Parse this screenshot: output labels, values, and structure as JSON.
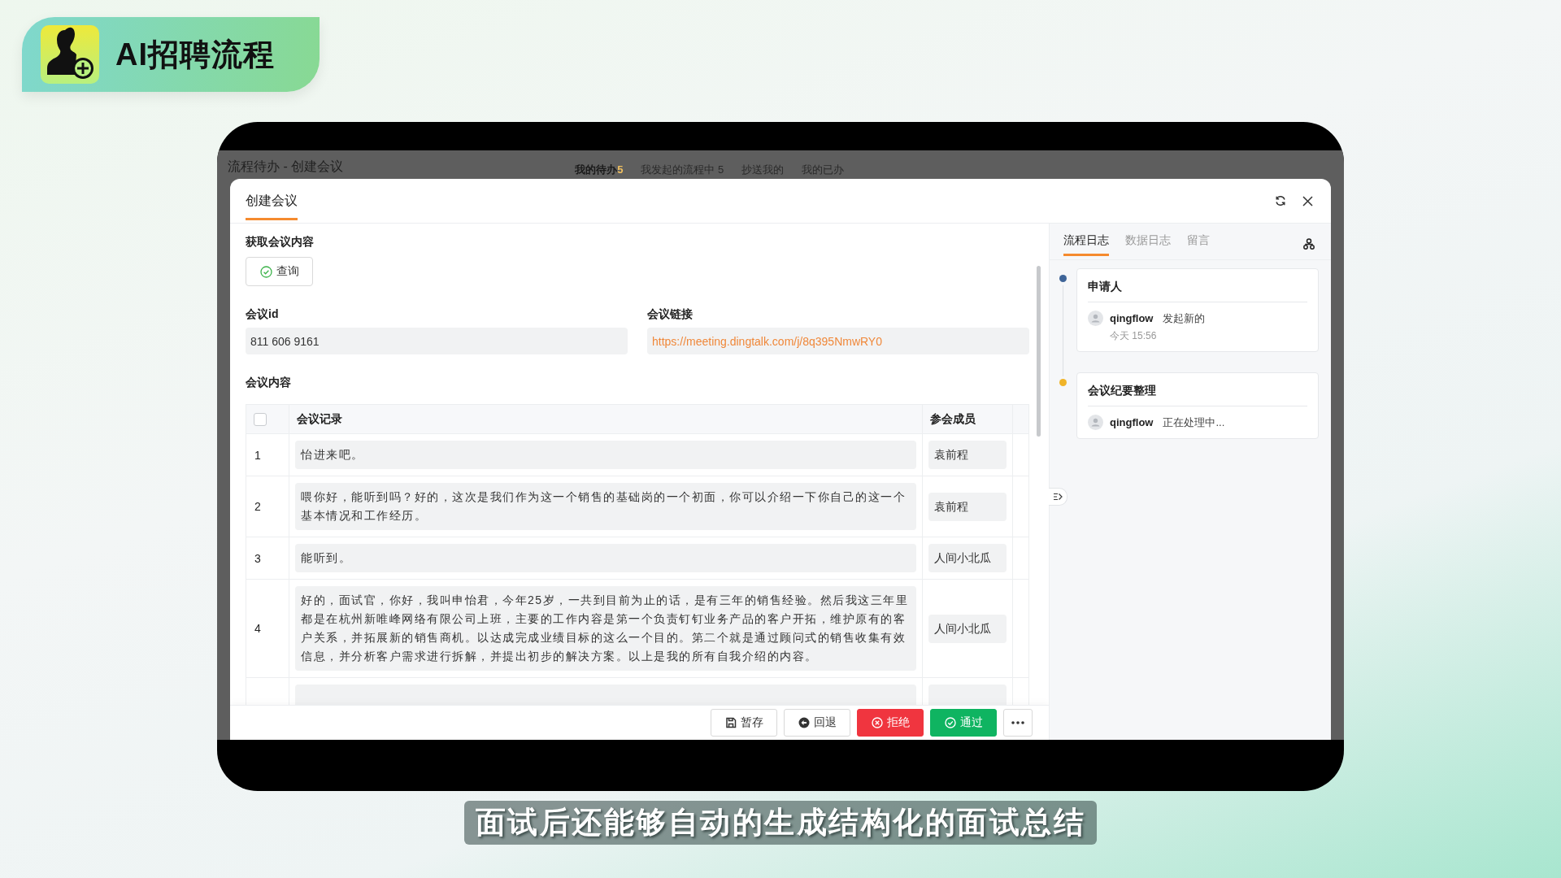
{
  "badge": {
    "title": "AI招聘流程"
  },
  "background_page": {
    "title": "流程待办 - 创建会议",
    "tabs": [
      {
        "label": "我的待办",
        "count": "5",
        "selected": true
      },
      {
        "label": "我发起的流程中 5",
        "selected": false
      },
      {
        "label": "抄送我的",
        "selected": false
      },
      {
        "label": "我的已办",
        "selected": false
      }
    ]
  },
  "modal": {
    "title": "创建会议",
    "fetch_label": "获取会议内容",
    "query_button": "查询",
    "fields": [
      {
        "label": "会议id",
        "value": "811 606 9161",
        "kind": "text"
      },
      {
        "label": "会议链接",
        "value": "https://meeting.dingtalk.com/j/8q395NmwRY0",
        "kind": "link"
      }
    ],
    "content_label": "会议内容",
    "table": {
      "columns": [
        "会议记录",
        "参会成员"
      ],
      "header_checked": false,
      "rows": [
        {
          "index": "1",
          "record": "怡进来吧。",
          "member": "袁前程"
        },
        {
          "index": "2",
          "record": "喂你好，能听到吗？好的，这次是我们作为这一个销售的基础岗的一个初面，你可以介绍一下你自己的这一个基本情况和工作经历。",
          "member": "袁前程"
        },
        {
          "index": "3",
          "record": "能听到。",
          "member": "人间小北瓜"
        },
        {
          "index": "4",
          "record": "好的，面试官，你好，我叫申怡君，今年25岁，一共到目前为止的话，是有三年的销售经验。然后我这三年里都是在杭州新唯峰网络有限公司上班，主要的工作内容是第一个负责钉钉业务产品的客户开拓，维护原有的客户关系，并拓展新的销售商机。以达成完成业绩目标的这么一个目的。第二个就是通过顾问式的销售收集有效信息，并分析客户需求进行拆解，并提出初步的解决方案。以上是我的所有自我介绍的内容。",
          "member": "人间小北瓜"
        }
      ]
    },
    "actions": [
      {
        "label": "暂存",
        "kind": "save"
      },
      {
        "label": "回退",
        "kind": "back"
      },
      {
        "label": "拒绝",
        "kind": "reject"
      },
      {
        "label": "通过",
        "kind": "approve"
      },
      {
        "kind": "more"
      }
    ]
  },
  "log_panel": {
    "tabs": [
      {
        "label": "流程日志",
        "selected": true
      },
      {
        "label": "数据日志",
        "selected": false
      },
      {
        "label": "留言",
        "selected": false
      }
    ],
    "entries": [
      {
        "title": "申请人",
        "user": "qingflow",
        "action": "发起新的",
        "time": "今天 15:56",
        "color": "#3e6498"
      },
      {
        "title": "会议纪要整理",
        "user": "qingflow",
        "action": "正在处理中...",
        "color": "#f0b429"
      }
    ]
  },
  "subtitle": "面试后还能够自动的生成结构化的面试总结"
}
